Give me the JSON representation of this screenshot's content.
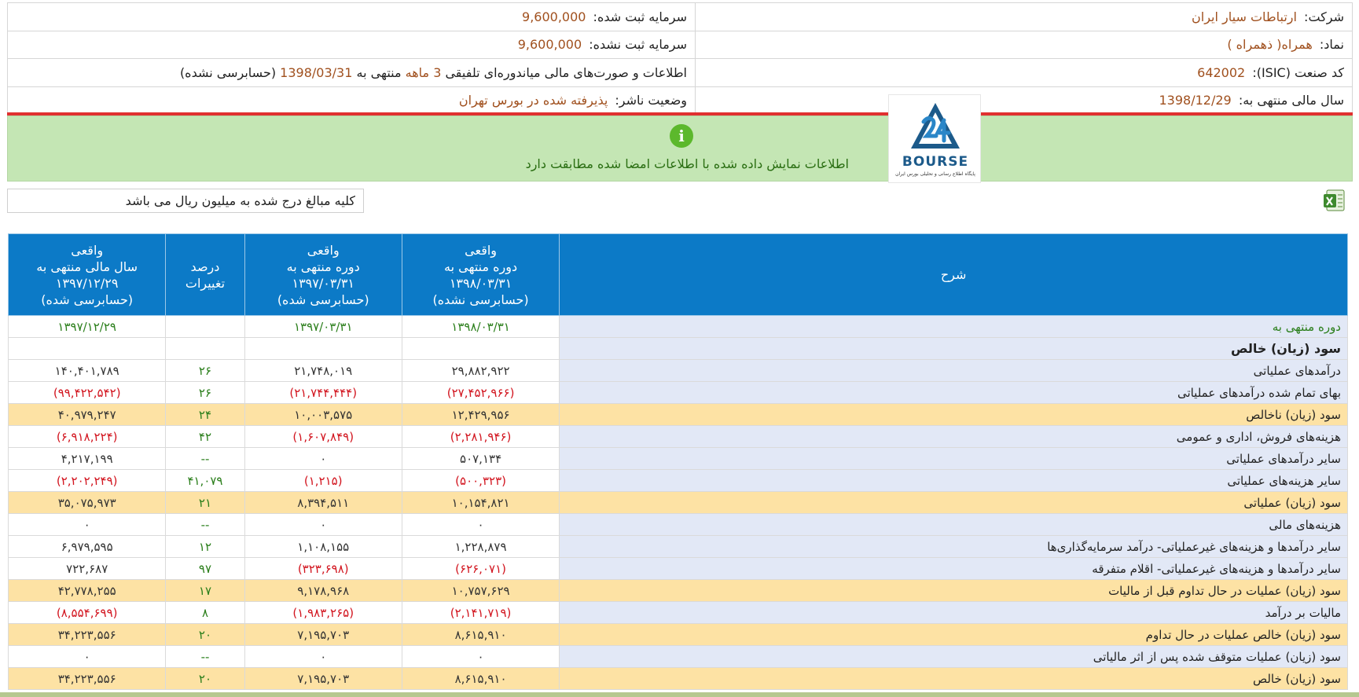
{
  "header": {
    "company_label": "شرکت:",
    "company_value": "ارتباطات سیار ایران",
    "registered_capital_label": "سرمایه ثبت شده:",
    "registered_capital_value": "9,600,000",
    "symbol_label": "نماد:",
    "symbol_value": "همراه( ذهمراه )",
    "unregistered_capital_label": "سرمایه ثبت نشده:",
    "unregistered_capital_value": "9,600,000",
    "isic_label": "کد صنعت (ISIC):",
    "isic_value": "642002",
    "report_text_a": "اطلاعات و صورت‌های مالی میاندوره‌ای تلفیقی",
    "report_period": "3 ماهه",
    "report_text_b": "منتهی به",
    "report_date": "1398/03/31",
    "report_text_c": "(حسابرسی نشده)",
    "fiscal_year_label": "سال مالی منتهی به:",
    "fiscal_year_value": "1398/12/29",
    "publisher_status_label": "وضعیت ناشر:",
    "publisher_status_value": "پذیرفته شده در بورس تهران"
  },
  "notice": {
    "icon": "info-icon",
    "text": "اطلاعات نمایش داده شده با اطلاعات امضا شده مطابقت دارد"
  },
  "logo": {
    "word": "BOURSE",
    "subtitle": "پایگاه اطلاع رسانی و تحلیلی بورس ایران"
  },
  "unit_note": "کلیه مبالغ درج شده به میلیون ریال می باشد",
  "excel_icon": "excel-icon",
  "table": {
    "columns": {
      "desc": "شرح",
      "c1": [
        "واقعی",
        "دوره منتهی به",
        "۱۳۹۸/۰۳/۳۱",
        "(حسابرسی نشده)"
      ],
      "c2": [
        "واقعی",
        "دوره منتهی به",
        "۱۳۹۷/۰۳/۳۱",
        "(حسابرسی شده)"
      ],
      "c3": [
        "درصد",
        "تغییرات"
      ],
      "c4": [
        "واقعی",
        "سال مالی منتهی به",
        "۱۳۹۷/۱۲/۲۹",
        "(حسابرسی شده)"
      ]
    },
    "rows": [
      {
        "desc": "دوره منتهی به",
        "c1": "۱۳۹۸/۰۳/۳۱",
        "c2": "۱۳۹۷/۰۳/۳۱",
        "c3": "",
        "c4": "۱۳۹۷/۱۲/۲۹"
      },
      {
        "desc": "سود (زیان) خالص",
        "c1": "",
        "c2": "",
        "c3": "",
        "c4": ""
      },
      {
        "desc": "درآمدهای عملیاتی",
        "c1": "۲۹,۸۸۲,۹۲۲",
        "c2": "۲۱,۷۴۸,۰۱۹",
        "c3": "۲۶",
        "c4": "۱۴۰,۴۰۱,۷۸۹"
      },
      {
        "desc": "بهای تمام شده درآمدهای عملیاتی",
        "c1": "(۲۷,۴۵۲,۹۶۶)",
        "c2": "(۲۱,۷۴۴,۴۴۴)",
        "c3": "۲۶",
        "c4": "(۹۹,۴۲۲,۵۴۲)"
      },
      {
        "desc": "سود (زیان) ناخالص",
        "c1": "۱۲,۴۲۹,۹۵۶",
        "c2": "۱۰,۰۰۳,۵۷۵",
        "c3": "۲۴",
        "c4": "۴۰,۹۷۹,۲۴۷"
      },
      {
        "desc": "هزینه‌های فروش، اداری و عمومی",
        "c1": "(۲,۲۸۱,۹۴۶)",
        "c2": "(۱,۶۰۷,۸۴۹)",
        "c3": "۴۲",
        "c4": "(۶,۹۱۸,۲۲۴)"
      },
      {
        "desc": "سایر درآمدهای عملیاتی",
        "c1": "۵۰۷,۱۳۴",
        "c2": "۰",
        "c3": "--",
        "c4": "۴,۲۱۷,۱۹۹"
      },
      {
        "desc": "سایر هزینه‌های عملیاتی",
        "c1": "(۵۰۰,۳۲۳)",
        "c2": "(۱,۲۱۵)",
        "c3": "۴۱,۰۷۹",
        "c4": "(۲,۲۰۲,۲۴۹)"
      },
      {
        "desc": "سود (زیان) عملیاتی",
        "c1": "۱۰,۱۵۴,۸۲۱",
        "c2": "۸,۳۹۴,۵۱۱",
        "c3": "۲۱",
        "c4": "۳۵,۰۷۵,۹۷۳"
      },
      {
        "desc": "هزینه‌های مالی",
        "c1": "۰",
        "c2": "۰",
        "c3": "--",
        "c4": "۰"
      },
      {
        "desc": "سایر درآمدها و هزینه‌های غیرعملیاتی- درآمد سرمایه‌گذاری‌ها",
        "c1": "۱,۲۲۸,۸۷۹",
        "c2": "۱,۱۰۸,۱۵۵",
        "c3": "۱۲",
        "c4": "۶,۹۷۹,۵۹۵"
      },
      {
        "desc": "سایر درآمدها و هزینه‌های غیرعملیاتی- اقلام متفرقه",
        "c1": "(۶۲۶,۰۷۱)",
        "c2": "(۳۲۳,۶۹۸)",
        "c3": "۹۷",
        "c4": "۷۲۲,۶۸۷"
      },
      {
        "desc": "سود (زیان) عملیات در حال تداوم قبل از مالیات",
        "c1": "۱۰,۷۵۷,۶۲۹",
        "c2": "۹,۱۷۸,۹۶۸",
        "c3": "۱۷",
        "c4": "۴۲,۷۷۸,۲۵۵"
      },
      {
        "desc": "مالیات بر درآمد",
        "c1": "(۲,۱۴۱,۷۱۹)",
        "c2": "(۱,۹۸۳,۲۶۵)",
        "c3": "۸",
        "c4": "(۸,۵۵۴,۶۹۹)"
      },
      {
        "desc": "سود (زیان) خالص عملیات در حال تداوم",
        "c1": "۸,۶۱۵,۹۱۰",
        "c2": "۷,۱۹۵,۷۰۳",
        "c3": "۲۰",
        "c4": "۳۴,۲۲۳,۵۵۶"
      },
      {
        "desc": "سود (زیان) عملیات متوقف شده پس از اثر مالیاتی",
        "c1": "۰",
        "c2": "۰",
        "c3": "--",
        "c4": "۰"
      },
      {
        "desc": "سود (زیان) خالص",
        "c1": "۸,۶۱۵,۹۱۰",
        "c2": "۷,۱۹۵,۷۰۳",
        "c3": "۲۰",
        "c4": "۳۴,۲۲۳,۵۵۶"
      }
    ]
  }
}
